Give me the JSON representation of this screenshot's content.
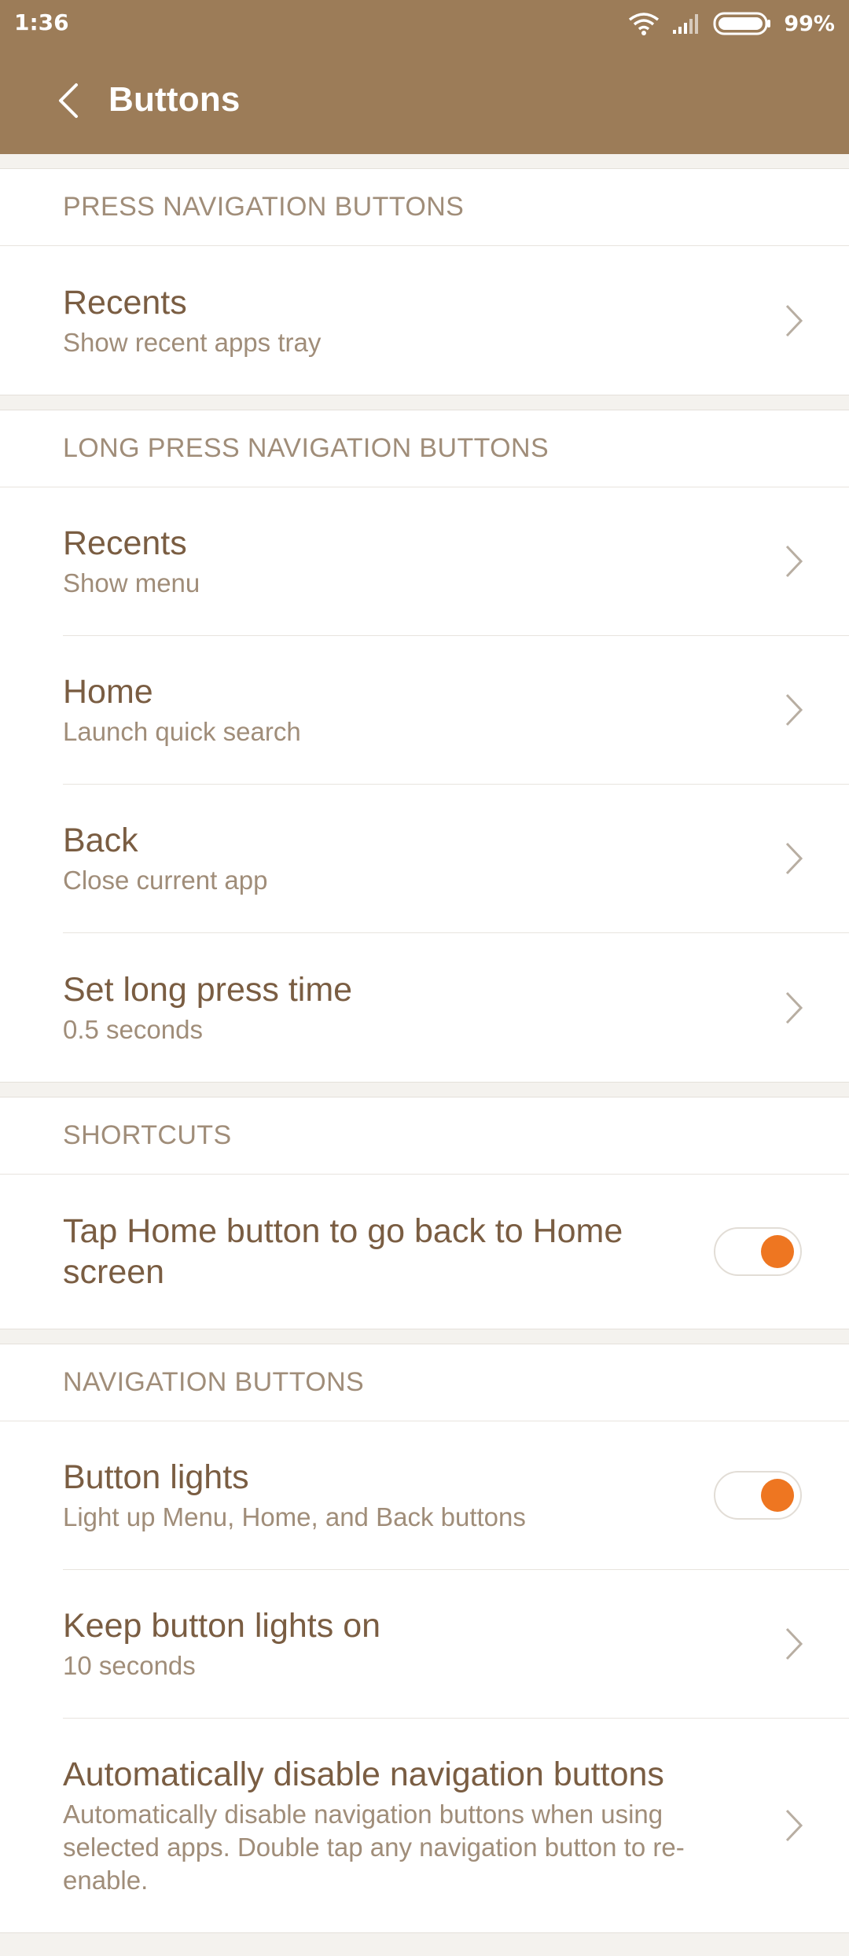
{
  "status_bar": {
    "time": "1:36",
    "battery_percent": "99%"
  },
  "app_bar": {
    "title": "Buttons"
  },
  "sections": [
    {
      "header": "PRESS NAVIGATION BUTTONS",
      "items": [
        {
          "title": "Recents",
          "subtitle": "Show recent apps tray"
        }
      ]
    },
    {
      "header": "LONG PRESS NAVIGATION BUTTONS",
      "items": [
        {
          "title": "Recents",
          "subtitle": "Show menu"
        },
        {
          "title": "Home",
          "subtitle": "Launch quick search"
        },
        {
          "title": "Back",
          "subtitle": "Close current app"
        },
        {
          "title": "Set long press time",
          "subtitle": "0.5 seconds"
        }
      ]
    },
    {
      "header": "SHORTCUTS",
      "items": [
        {
          "title": "Tap Home button to go back to Home screen",
          "toggle_on": true
        }
      ]
    },
    {
      "header": "NAVIGATION BUTTONS",
      "items": [
        {
          "title": "Button lights",
          "subtitle": "Light up Menu, Home, and Back buttons",
          "toggle_on": true
        },
        {
          "title": "Keep button lights on",
          "subtitle": "10 seconds"
        },
        {
          "title": "Automatically disable navigation buttons",
          "subtitle": "Automatically disable navigation buttons when using selected apps. Double tap any navigation button to re-enable."
        }
      ]
    }
  ],
  "colors": {
    "header_bg": "#9c7c58",
    "accent": "#ee7621",
    "title_text": "#7a5d42",
    "secondary_text": "#a08d79"
  }
}
